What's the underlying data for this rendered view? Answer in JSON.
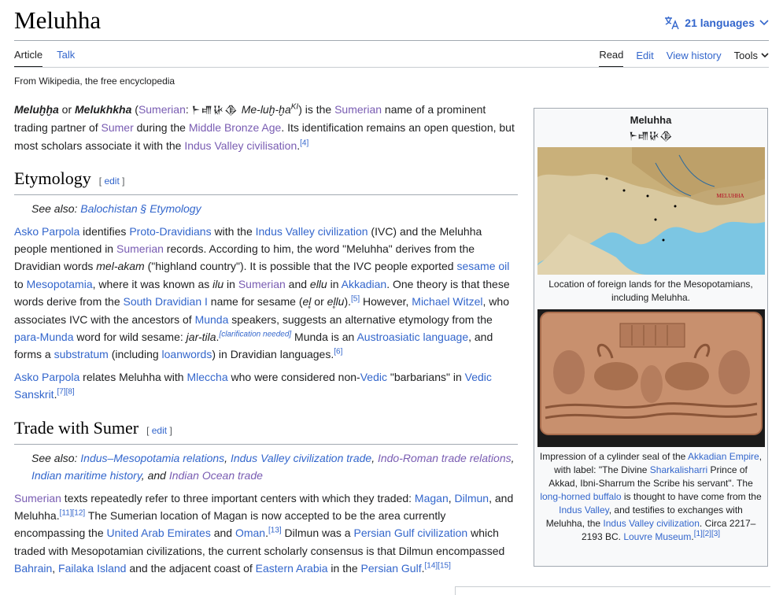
{
  "page": {
    "title": "Meluhha",
    "languages_label": "21 languages",
    "tabs_left": [
      "Article",
      "Talk"
    ],
    "tabs_right": [
      "Read",
      "Edit",
      "View history"
    ],
    "tools_label": "Tools",
    "from_line": "From Wikipedia, the free encyclopedia"
  },
  "intro": {
    "term1": "Meluḫḫa",
    "or": " or ",
    "term2": "Melukhkha",
    "paren_open": " (",
    "sumerian_link": "Sumerian",
    "colon": ": ",
    "cuneiform": "𒈨𒈛𒄩𒆠",
    "translit": "Me-luḫ-ḫa",
    "ki": "KI",
    "mid1": ") is the ",
    "sumerian2": "Sumerian",
    "mid2": " name of a prominent trading partner of ",
    "sumer": "Sumer",
    "mid3": " during the ",
    "mba": "Middle Bronze Age",
    "mid4": ". Its identification remains an open question, but most scholars associate it with the ",
    "ivc": "Indus Valley civilisation",
    "end": ".",
    "ref": "[4]"
  },
  "etymology": {
    "heading": "Etymology",
    "edit_label": "edit",
    "see_also_prefix": "See also: ",
    "see_also_link": "Balochistan § Etymology",
    "p1": {
      "asko": "Asko Parpola",
      "t1": " identifies ",
      "proto": "Proto-Dravidians",
      "t2": " with the ",
      "ivc": "Indus Valley civilization",
      "t3": " (IVC) and the Meluhha people mentioned in ",
      "sumerian": "Sumerian",
      "t4": " records. According to him, the word \"Meluhha\" derives from the Dravidian words ",
      "melakam": "mel-akam",
      "t5": " (\"highland country\"). It is possible that the IVC people exported ",
      "sesame": "sesame oil",
      "t6": " to ",
      "meso": "Mesopotamia",
      "t7": ", where it was known as ",
      "ilu": "ilu",
      "t8": " in ",
      "sumerian2": "Sumerian",
      "t9": " and ",
      "ellu": "ellu",
      "t10": " in ",
      "akkadian": "Akkadian",
      "t11": ". One theory is that these words derive from the ",
      "sdrav": "South Dravidian I",
      "t12": " name for sesame (",
      "el": "el̥",
      "t13": " or ",
      "ellu2": "el̥lu",
      "t14": ").",
      "ref5": "[5]",
      "t15": " However, ",
      "witzel": "Michael Witzel",
      "t16": ", who associates IVC with the ancestors of ",
      "munda": "Munda",
      "t17": " speakers, suggests an alternative etymology from the ",
      "paramunda": "para-Munda",
      "t18": " word for wild sesame: ",
      "jartila": "jar-tila",
      "t19": ".",
      "clar": "[clarification needed]",
      "t20": " Munda is an ",
      "austro": "Austroasiatic language",
      "t21": ", and forms a ",
      "substratum": "substratum",
      "t22": " (including ",
      "loanwords": "loanwords",
      "t23": ") in Dravidian languages.",
      "ref6": "[6]"
    },
    "p2": {
      "asko": "Asko Parpola",
      "t1": " relates Meluhha with ",
      "mleccha": "Mleccha",
      "t2": " who were considered non-",
      "vedic": "Vedic",
      "t3": " \"barbarians\" in ",
      "vsk": "Vedic Sanskrit",
      "t4": ".",
      "ref": "[7][8]"
    }
  },
  "trade": {
    "heading": "Trade with Sumer",
    "edit_label": "edit",
    "see_also_prefix": "See also: ",
    "links": [
      "Indus–Mesopotamia relations",
      "Indus Valley civilization trade",
      "Indo-Roman trade relations",
      "Indian maritime history",
      "Indian Ocean trade"
    ],
    "sep1": ", ",
    "and": ", and ",
    "p1": {
      "sumerian": "Sumerian",
      "t1": " texts repeatedly refer to three important centers with which they traded: ",
      "magan": "Magan",
      "t2": ", ",
      "dilmun": "Dilmun",
      "t3": ", and Meluhha.",
      "ref1": "[11][12]",
      "t4": " The Sumerian location of Magan is now accepted to be the area currently encompassing the ",
      "uae": "United Arab Emirates",
      "t5": " and ",
      "oman": "Oman",
      "t6": ".",
      "ref2": "[13]",
      "t7": " Dilmun was a ",
      "pg": "Persian Gulf",
      "t8": " ",
      "civ": "civilization",
      "t9": " which traded with Mesopotamian civilizations, the current scholarly consensus is that Dilmun encompassed ",
      "bahrain": "Bahrain",
      "t10": ", ",
      "failaka": "Failaka Island",
      "t11": " and the adjacent coast of ",
      "earabia": "Eastern Arabia",
      "t12": " in the ",
      "pg2": "Persian Gulf",
      "t13": ".",
      "ref3": "[14][15]"
    }
  },
  "infobox": {
    "title": "Meluhha",
    "cuneiform": "𒈨𒈛𒄩𒆠",
    "map_caption": "Location of foreign lands for the Mesopotamians, including Meluhha.",
    "map_label": "MELUHHA",
    "seal_caption": {
      "t1": "Impression of a cylinder seal of the ",
      "akk": "Akkadian Empire",
      "t2": ", with label: \"The Divine ",
      "shar": "Sharkalisharri",
      "t3": " Prince of Akkad, Ibni-Sharrum the Scribe his servant\". The ",
      "buffalo": "long-horned buffalo",
      "t4": " is thought to have come from the ",
      "iv": "Indus Valley",
      "t5": ", and testifies to exchanges with Meluhha, the ",
      "ivc": "Indus Valley civilization",
      "t6": ". Circa 2217–2193 BC. ",
      "louvre": "Louvre Museum",
      "t7": ".",
      "ref": "[1][2][3]"
    }
  },
  "colors": {
    "link": "#3366cc",
    "visited": "#795cb2",
    "text": "#202122",
    "border": "#a2a9b1"
  }
}
